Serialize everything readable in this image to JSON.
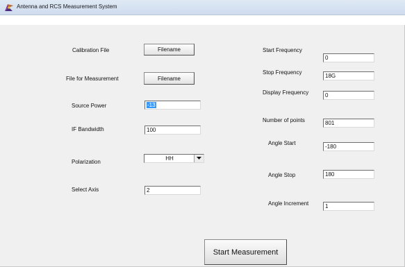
{
  "window": {
    "title": "Antenna and RCS Measurement System",
    "icon": "app-icon"
  },
  "left": {
    "calibration_file_label": "Calibration File",
    "calibration_file_button": "Filename",
    "measurement_file_label": "File for Measurement",
    "measurement_file_button": "Filename",
    "source_power_label": "Source Power",
    "source_power_value": "-13",
    "if_bandwidth_label": "IF Bandwidth",
    "if_bandwidth_value": "100",
    "polarization_label": "Polarization",
    "polarization_value": "HH",
    "select_axis_label": "Select Axis",
    "select_axis_value": "2"
  },
  "right": {
    "start_frequency_label": "Start Frequency",
    "start_frequency_value": "0",
    "stop_frequency_label": "Stop Frequency",
    "stop_frequency_value": "18G",
    "display_frequency_label": "Display Frequency",
    "display_frequency_value": "0",
    "number_of_points_label": "Number of points",
    "number_of_points_value": "801",
    "angle_start_label": "Angle Start",
    "angle_start_value": "-180",
    "angle_stop_label": "Angle Stop",
    "angle_stop_value": "180",
    "angle_increment_label": "Angle Increment",
    "angle_increment_value": "1"
  },
  "actions": {
    "start_measurement": "Start Measurement"
  }
}
